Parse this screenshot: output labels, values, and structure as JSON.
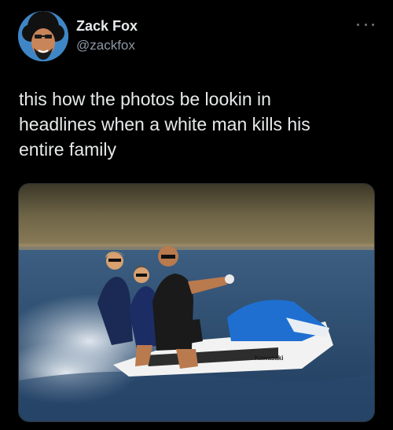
{
  "tweet": {
    "author": {
      "display_name": "Zack Fox",
      "handle": "@zackfox",
      "avatar_icon": "avatar-illustration"
    },
    "more_icon": "ellipsis-icon",
    "text_lines": [
      "this how the photos be lookin in",
      "headlines when a white man kills his",
      "entire family"
    ],
    "media": {
      "brand_text": "Kawasaki"
    }
  },
  "colors": {
    "background": "#000000",
    "primary_text": "#e7e9ea",
    "secondary_text": "#8b98a5",
    "border": "#2f3336"
  }
}
